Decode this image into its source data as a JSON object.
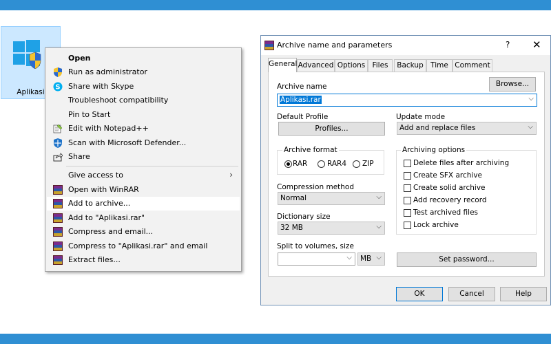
{
  "desktop": {
    "icon_label": "Aplikasi"
  },
  "context_menu": {
    "items": [
      {
        "label": "Open",
        "bold": true
      },
      {
        "label": "Run as administrator"
      },
      {
        "label": "Share with Skype"
      },
      {
        "label": "Troubleshoot compatibility"
      },
      {
        "label": "Pin to Start"
      },
      {
        "label": "Edit with Notepad++"
      },
      {
        "label": "Scan with Microsoft Defender..."
      },
      {
        "label": "Share"
      },
      {
        "label": "Give access to"
      },
      {
        "label": "Open with WinRAR"
      },
      {
        "label": "Add to archive..."
      },
      {
        "label": "Add to \"Aplikasi.rar\""
      },
      {
        "label": "Compress and email..."
      },
      {
        "label": "Compress to \"Aplikasi.rar\" and email"
      },
      {
        "label": "Extract files..."
      }
    ]
  },
  "dialog": {
    "title": "Archive name and parameters",
    "help": "?",
    "close": "✕",
    "tabs": [
      "General",
      "Advanced",
      "Options",
      "Files",
      "Backup",
      "Time",
      "Comment"
    ],
    "archive_name_label": "Archive name",
    "archive_name_value": "Aplikasi.rar",
    "browse_label": "Browse...",
    "default_profile_label": "Default Profile",
    "profiles_button": "Profiles...",
    "update_mode_label": "Update mode",
    "update_mode_value": "Add and replace files",
    "archive_format_label": "Archive format",
    "formats": [
      "RAR",
      "RAR4",
      "ZIP"
    ],
    "compression_label": "Compression method",
    "compression_value": "Normal",
    "dictionary_label": "Dictionary size",
    "dictionary_value": "32 MB",
    "split_label": "Split to volumes, size",
    "split_value": "",
    "split_unit": "MB",
    "archiving_options_label": "Archiving options",
    "options": [
      "Delete files after archiving",
      "Create SFX archive",
      "Create solid archive",
      "Add recovery record",
      "Test archived files",
      "Lock archive"
    ],
    "set_password": "Set password...",
    "ok": "OK",
    "cancel": "Cancel",
    "help_button": "Help"
  }
}
